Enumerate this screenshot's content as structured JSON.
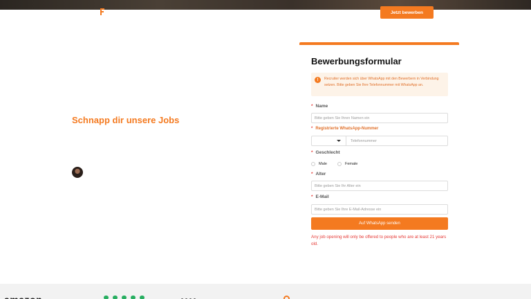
{
  "header": {
    "apply_button": "Jetzt bewerben"
  },
  "hero": {
    "slogan": "Schnapp dir unsere Jobs"
  },
  "form": {
    "title": "Bewerbungsformular",
    "notice": "Recruiter werden sich über WhatsApp mit den Bewerbern in Verbindung setzen. Bitte geben Sie Ihre Telefonnummer mit WhatsApp an.",
    "name_label": "Name",
    "name_placeholder": "Bitte geben Sie Ihren Namen ein",
    "whatsapp_label": "Registrierte WhatsApp-Nummer",
    "phone_placeholder": "Telefonnummer",
    "gender_label": "Geschlecht",
    "gender_options": [
      "Male",
      "Female"
    ],
    "age_label": "Alter",
    "age_placeholder": "Bitte geben Sie Ihr Alter ein",
    "email_label": "E-Mail",
    "email_placeholder": "Bitte geben Sie Ihre E-Mail-Adresse ein",
    "submit_label": "Auf WhatsApp senden",
    "disclaimer": "Any job opening will only be offered to people who are at least 21 years old."
  },
  "footer": {
    "brand_1": "amazon"
  },
  "icons": {
    "notice": "info-icon",
    "logo": "brand-logo-icon",
    "select_caret": "chevron-down-icon"
  },
  "colors": {
    "accent": "#f47a20",
    "error": "#e53935",
    "notice_bg": "#fdf3e8"
  }
}
